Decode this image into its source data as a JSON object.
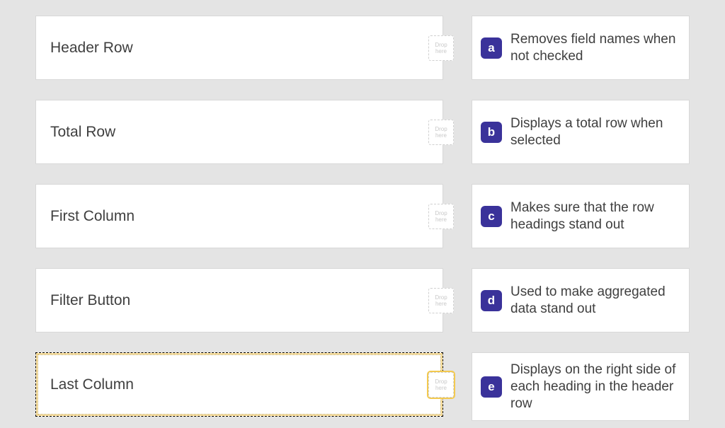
{
  "dropText1": "Drop",
  "dropText2": "here",
  "prompts": [
    {
      "label": "Header Row",
      "active": false
    },
    {
      "label": "Total Row",
      "active": false
    },
    {
      "label": "First Column",
      "active": false
    },
    {
      "label": "Filter Button",
      "active": false
    },
    {
      "label": "Last Column",
      "active": true
    }
  ],
  "answers": [
    {
      "letter": "a",
      "text": "Removes field names when not checked"
    },
    {
      "letter": "b",
      "text": "Displays a total row when selected"
    },
    {
      "letter": "c",
      "text": "Makes sure that the row headings stand out"
    },
    {
      "letter": "d",
      "text": "Used to make aggregated data stand out"
    },
    {
      "letter": "e",
      "text": "Displays on the right side of each heading in the header row"
    }
  ]
}
